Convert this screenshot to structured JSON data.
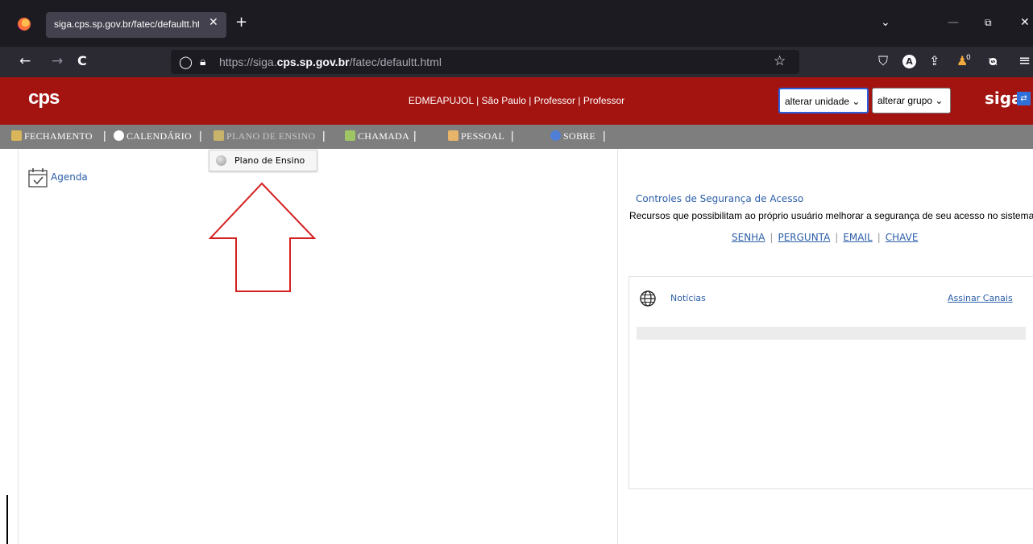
{
  "browser": {
    "tab_title": "siga.cps.sp.gov.br/fatec/defaultt.html",
    "tab_close_icon": "close-icon",
    "new_tab_symbol": "+",
    "url_prefix": "https://siga.",
    "url_domain": "cps.sp.gov.br",
    "url_path": "/fatec/defaultt.html",
    "back_symbol": "←",
    "forward_symbol": "→",
    "reload_symbol": "C",
    "shield_symbol": "◯",
    "lock_symbol": "🔒︎",
    "star_symbol": "☆",
    "chevron_symbol": "⌄",
    "minimize_symbol": "—",
    "restore_symbol": "⧉",
    "close_symbol": "✕",
    "pocket_symbol": "⛉",
    "account_symbol": "A",
    "share_symbol": "⇪",
    "extension_symbol": "♟",
    "extension_badge": "0",
    "sync_symbol": "ᴓ",
    "menu_symbol": "≡"
  },
  "header": {
    "logo": "cps",
    "user_line": "EDMEAPUJOL | São Paulo | Professor | Professor",
    "unit_select": "alterar unidade",
    "group_select": "alterar grupo",
    "siga_logo": "siga",
    "siga_badge": "⇄",
    "brand_color": "#a31411"
  },
  "menu": {
    "items": [
      {
        "label": "FECHAMENTO",
        "icon": "calendar-icon"
      },
      {
        "label": "CALENDÁRIO",
        "icon": "clock-icon"
      },
      {
        "label": "PLANO DE ENSINO",
        "icon": "chart-icon"
      },
      {
        "label": "CHAMADA",
        "icon": "calendar-check-icon"
      },
      {
        "label": "PESSOAL",
        "icon": "people-icon"
      },
      {
        "label": "SOBRE",
        "icon": "help-icon"
      }
    ],
    "separator": "|",
    "submenu": {
      "item": "Plano de Ensino"
    }
  },
  "left": {
    "agenda_label": "Agenda"
  },
  "security": {
    "title": "Controles de Segurança de Acesso",
    "description": "Recursos que possibilitam ao próprio usuário melhorar a segurança de seu acesso no sistema.",
    "links": [
      "SENHA",
      "PERGUNTA",
      "EMAIL",
      "CHAVE"
    ],
    "separator": "|"
  },
  "news": {
    "title": "Notícias",
    "subscribe": "Assinar Canais"
  }
}
